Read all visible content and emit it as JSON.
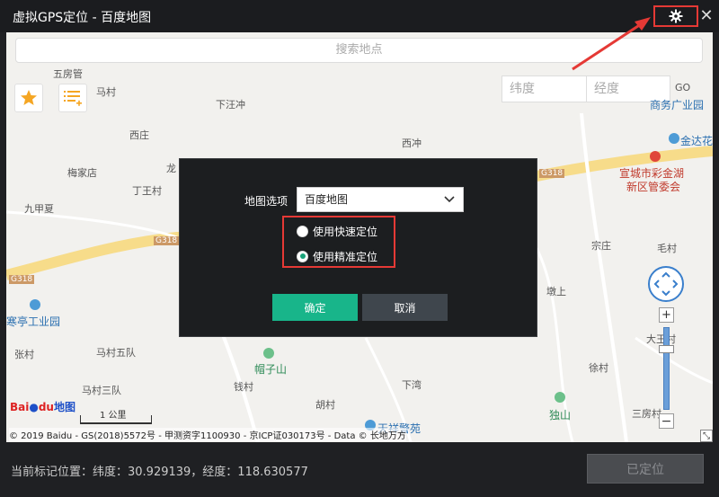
{
  "window": {
    "title": "虚拟GPS定位 - 百度地图",
    "close_glyph": "✕"
  },
  "map": {
    "search_placeholder": "搜索地点",
    "latitude_placeholder": "纬度",
    "longitude_placeholder": "经度",
    "go_label": "GO",
    "scale_label": "1 公里",
    "logo_text": "Bai",
    "logo_du": "du",
    "logo_suffix": "地图",
    "copyright": "© 2019 Baidu - GS(2018)5572号 - 甲测资字1100930 - 京ICP证030173号 - Data © 长地万方",
    "places": {
      "wufangguan": "五房管",
      "macun": "马村",
      "xiawangchong": "下汪冲",
      "xizhuang": "西庄",
      "xichong": "西冲",
      "meijiadian": "梅家店",
      "long": "龙",
      "dingwangcun": "丁王村",
      "jiuyixia": "九甲夏",
      "zongzhuang": "宗庄",
      "maocun": "毛村",
      "dunshang": "墩上",
      "dawangcun": "大王村",
      "xucun": "徐村",
      "hanting": "寒亭工业园",
      "zhangcun": "张村",
      "macunwudui": "马村五队",
      "maozishan": "帽子山",
      "macunsandui": "马村三队",
      "qiancun": "钱村",
      "hucun": "胡村",
      "xiachong": "下湾",
      "dushan": "独山",
      "sanfangcun": "三房村",
      "xuancheng": "宣城市彩金湖",
      "xinqu": "新区管委会",
      "jinda": "金达花",
      "shangye": "商务广业园",
      "tianxiang": "天祥警苑",
      "road_g318_a": "G318",
      "road_g318_b": "G318",
      "road_g318_c": "G318"
    }
  },
  "dialog": {
    "map_option_label": "地图选项",
    "map_option_value": "百度地图",
    "radio_fast": "使用快速定位",
    "radio_precise": "使用精准定位",
    "selected_radio": "precise",
    "ok_label": "确定",
    "cancel_label": "取消"
  },
  "status": {
    "current_position": "当前标记位置：纬度：30.929139，经度：118.630577",
    "located_button": "已定位"
  },
  "colors": {
    "accent_green": "#18b58a",
    "highlight_red": "#e53935",
    "title_bg": "#1b1c1f"
  }
}
